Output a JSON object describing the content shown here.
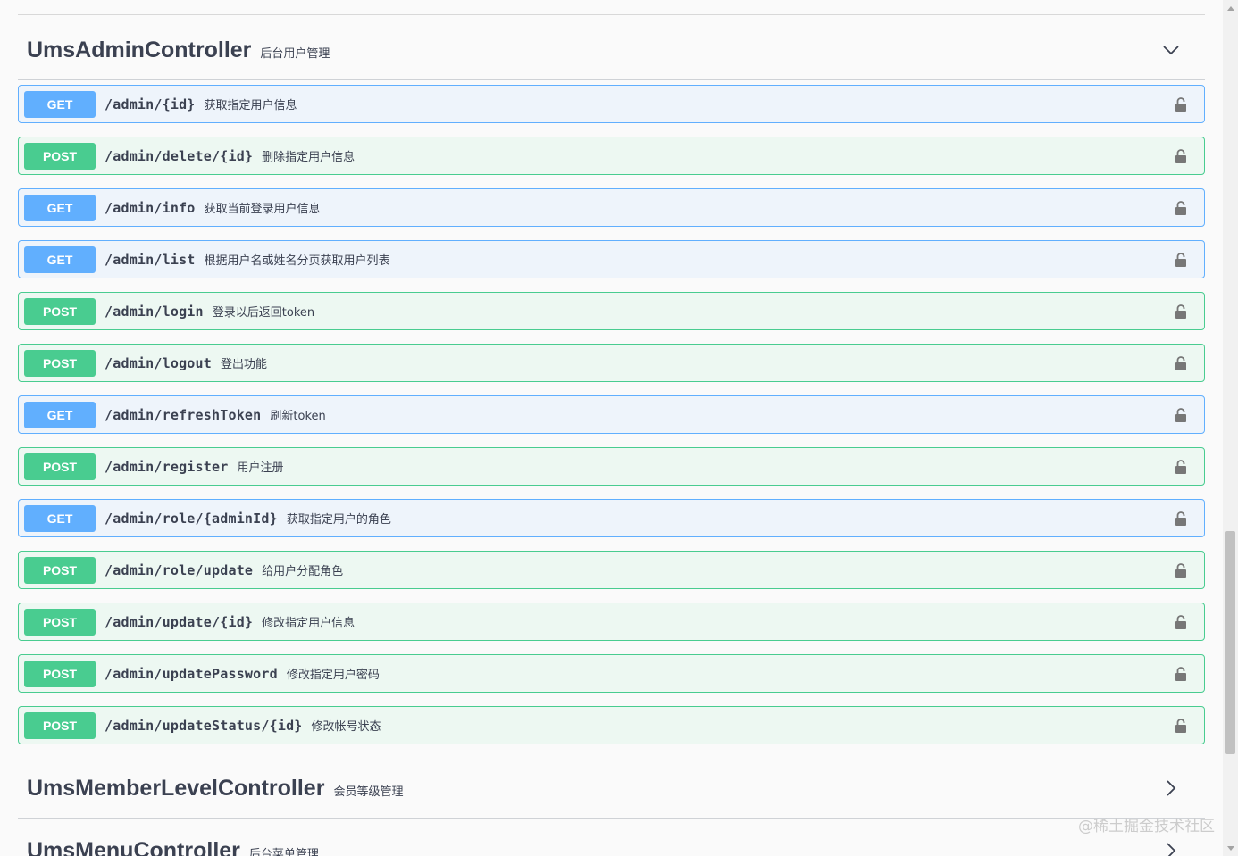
{
  "sections": {
    "admin": {
      "name": "UmsAdminController",
      "description": "后台用户管理",
      "expanded": true
    },
    "member_level": {
      "name": "UmsMemberLevelController",
      "description": "会员等级管理",
      "expanded": false
    },
    "menu": {
      "name": "UmsMenuController",
      "description": "后台菜单管理",
      "expanded": false
    }
  },
  "operations": [
    {
      "method": "GET",
      "path": "/admin/{id}",
      "summary": "获取指定用户信息"
    },
    {
      "method": "POST",
      "path": "/admin/delete/{id}",
      "summary": "删除指定用户信息"
    },
    {
      "method": "GET",
      "path": "/admin/info",
      "summary": "获取当前登录用户信息"
    },
    {
      "method": "GET",
      "path": "/admin/list",
      "summary": "根据用户名或姓名分页获取用户列表"
    },
    {
      "method": "POST",
      "path": "/admin/login",
      "summary": "登录以后返回token"
    },
    {
      "method": "POST",
      "path": "/admin/logout",
      "summary": "登出功能"
    },
    {
      "method": "GET",
      "path": "/admin/refreshToken",
      "summary": "刷新token"
    },
    {
      "method": "POST",
      "path": "/admin/register",
      "summary": "用户注册"
    },
    {
      "method": "GET",
      "path": "/admin/role/{adminId}",
      "summary": "获取指定用户的角色"
    },
    {
      "method": "POST",
      "path": "/admin/role/update",
      "summary": "给用户分配角色"
    },
    {
      "method": "POST",
      "path": "/admin/update/{id}",
      "summary": "修改指定用户信息"
    },
    {
      "method": "POST",
      "path": "/admin/updatePassword",
      "summary": "修改指定用户密码"
    },
    {
      "method": "POST",
      "path": "/admin/updateStatus/{id}",
      "summary": "修改帐号状态"
    }
  ],
  "colors": {
    "get_accent": "#61affe",
    "post_accent": "#49cc90",
    "get_bg": "#eef4fb",
    "post_bg": "#edf8f2",
    "text": "#3b4151"
  },
  "icons": {
    "expand": "chevron-down-icon",
    "collapse": "chevron-right-icon",
    "auth": "lock-icon"
  },
  "watermark": "@稀土掘金技术社区"
}
